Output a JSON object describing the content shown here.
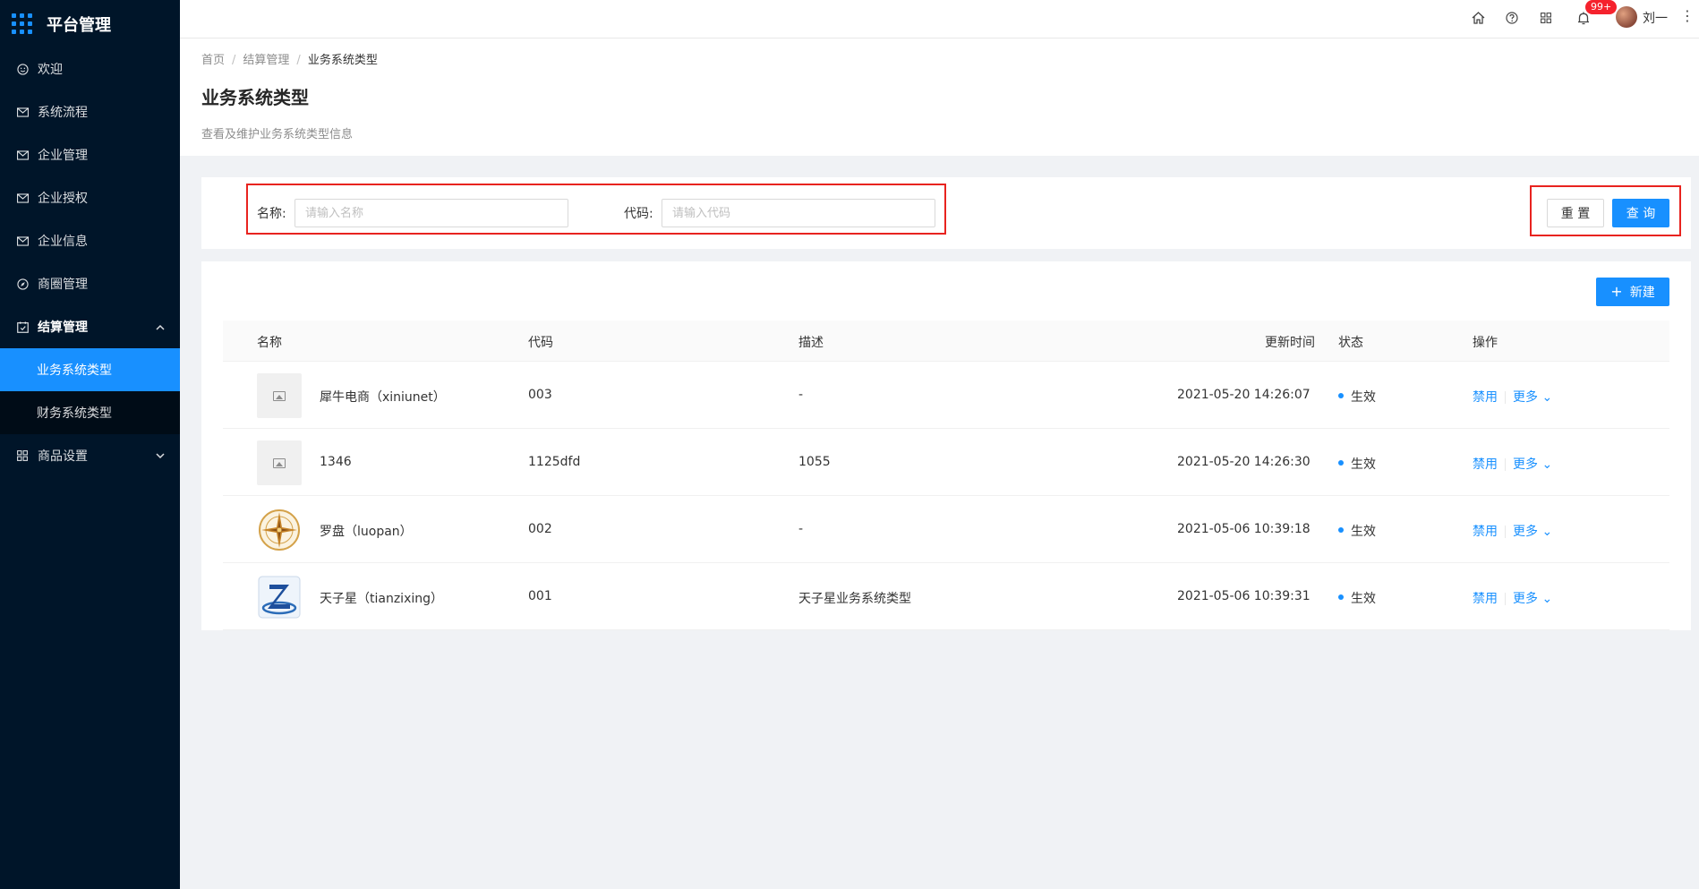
{
  "sidebar": {
    "title": "平台管理",
    "items": [
      {
        "label": "欢迎",
        "icon": "smile-icon"
      },
      {
        "label": "系统流程",
        "icon": "mail-icon"
      },
      {
        "label": "企业管理",
        "icon": "mail-icon"
      },
      {
        "label": "企业授权",
        "icon": "mail-icon"
      },
      {
        "label": "企业信息",
        "icon": "mail-icon"
      },
      {
        "label": "商圈管理",
        "icon": "compass-icon"
      },
      {
        "label": "结算管理",
        "icon": "calendar-icon",
        "expanded": true
      },
      {
        "label": "商品设置",
        "icon": "appstore-icon"
      }
    ],
    "sub_items": [
      {
        "label": "业务系统类型",
        "active": true
      },
      {
        "label": "财务系统类型",
        "active": false
      }
    ]
  },
  "header": {
    "icons": [
      "home-icon",
      "question-icon",
      "apps-icon",
      "bell-icon"
    ],
    "badge": "99+",
    "username": "刘一"
  },
  "breadcrumb": [
    "首页",
    "结算管理",
    "业务系统类型"
  ],
  "page": {
    "title": "业务系统类型",
    "description": "查看及维护业务系统类型信息"
  },
  "search": {
    "name_label": "名称:",
    "name_placeholder": "请输入名称",
    "code_label": "代码:",
    "code_placeholder": "请输入代码",
    "reset_label": "重 置",
    "query_label": "查 询"
  },
  "toolbar": {
    "new_label": "新建"
  },
  "table": {
    "columns": [
      "名称",
      "代码",
      "描述",
      "更新时间",
      "状态",
      "操作"
    ],
    "rows": [
      {
        "thumb": "placeholder",
        "name": "犀牛电商（xiniunet）",
        "code": "003",
        "desc": "-",
        "updated": "2021-05-20 14:26:07",
        "status": "生效",
        "action1": "禁用",
        "action2": "更多"
      },
      {
        "thumb": "placeholder",
        "name": "1346",
        "code": "1125dfd",
        "desc": "1055",
        "updated": "2021-05-20 14:26:30",
        "status": "生效",
        "action1": "禁用",
        "action2": "更多"
      },
      {
        "thumb": "compass-logo",
        "name": "罗盘（luopan）",
        "code": "002",
        "desc": "-",
        "updated": "2021-05-06 10:39:18",
        "status": "生效",
        "action1": "禁用",
        "action2": "更多"
      },
      {
        "thumb": "z-logo",
        "name": "天子星（tianzixing）",
        "code": "001",
        "desc": "天子星业务系统类型",
        "updated": "2021-05-06 10:39:31",
        "status": "生效",
        "action1": "禁用",
        "action2": "更多"
      }
    ]
  },
  "colors": {
    "sidebar_bg": "#001529",
    "primary": "#1890ff",
    "highlight": "#e8231f",
    "badge": "#f5222d"
  }
}
